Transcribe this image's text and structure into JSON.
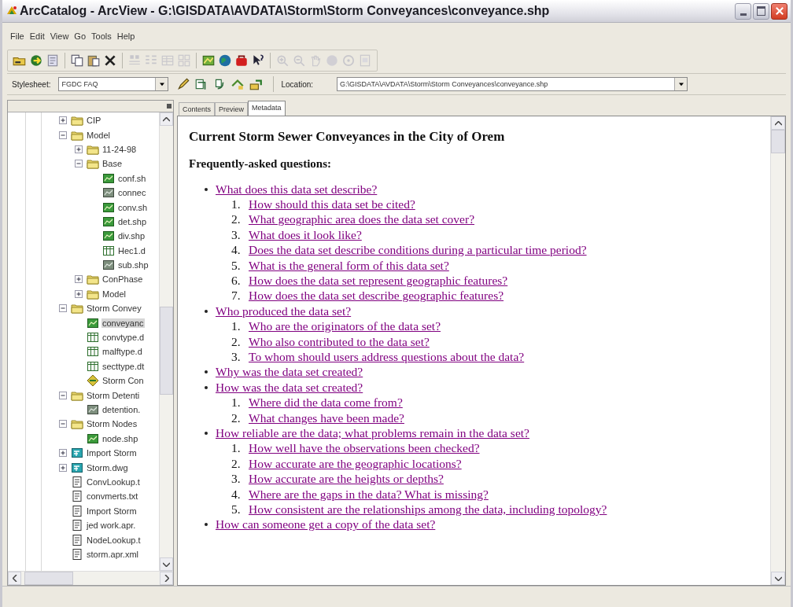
{
  "window": {
    "title": "ArcCatalog - ArcView - G:\\GISDATA\\AVDATA\\Storm\\Storm Conveyances\\conveyance.shp"
  },
  "menu": [
    "File",
    "Edit",
    "View",
    "Go",
    "Tools",
    "Help"
  ],
  "toolbar": [
    {
      "kind": "connect",
      "disabled": false
    },
    {
      "kind": "disconnect",
      "disabled": false
    },
    {
      "kind": "properties",
      "disabled": false
    },
    {
      "kind": "sep"
    },
    {
      "kind": "copy",
      "disabled": false
    },
    {
      "kind": "paste",
      "disabled": false
    },
    {
      "kind": "delete",
      "disabled": false
    },
    {
      "kind": "sep"
    },
    {
      "kind": "large-icons",
      "disabled": true
    },
    {
      "kind": "list",
      "disabled": true
    },
    {
      "kind": "details",
      "disabled": true
    },
    {
      "kind": "thumbnails",
      "disabled": true
    },
    {
      "kind": "sep"
    },
    {
      "kind": "arcmap",
      "disabled": false
    },
    {
      "kind": "globe",
      "disabled": false
    },
    {
      "kind": "toolbox",
      "disabled": false
    },
    {
      "kind": "help",
      "disabled": false
    },
    {
      "kind": "sep"
    },
    {
      "kind": "zoom-in",
      "disabled": true
    },
    {
      "kind": "zoom-out",
      "disabled": true
    },
    {
      "kind": "pan",
      "disabled": true
    },
    {
      "kind": "full-extent",
      "disabled": true
    },
    {
      "kind": "identify",
      "disabled": true
    },
    {
      "kind": "thumbnail",
      "disabled": true
    }
  ],
  "metadata_toolbar": {
    "stylesheet_label": "Stylesheet:",
    "stylesheet": "FGDC FAQ",
    "buttons": [
      {
        "kind": "edit",
        "disabled": false
      },
      {
        "kind": "properties-edit",
        "disabled": false
      },
      {
        "kind": "import",
        "disabled": false
      },
      {
        "kind": "export",
        "disabled": false
      },
      {
        "kind": "update",
        "disabled": false
      }
    ],
    "location_label": "Location:",
    "location": "G:\\GISDATA\\AVDATA\\Storm\\Storm Conveyances\\conveyance.shp"
  },
  "tree": [
    {
      "label": "CIP",
      "kind": "folder",
      "expanded": false
    },
    {
      "label": "Model",
      "kind": "folder",
      "expanded": true,
      "children": [
        {
          "label": "11-24-98",
          "kind": "folder",
          "expanded": false
        },
        {
          "label": "Base",
          "kind": "folder",
          "expanded": true,
          "children": [
            {
              "label": "conf.sh",
              "kind": "shapefile"
            },
            {
              "label": "connec",
              "kind": "dataset"
            },
            {
              "label": "conv.sh",
              "kind": "shapefile"
            },
            {
              "label": "det.shp",
              "kind": "shapefile"
            },
            {
              "label": "div.shp",
              "kind": "shapefile"
            },
            {
              "label": "Hec1.d",
              "kind": "table"
            },
            {
              "label": "sub.shp",
              "kind": "dataset"
            }
          ]
        },
        {
          "label": "ConPhase",
          "kind": "folder",
          "expanded": false
        },
        {
          "label": "Model",
          "kind": "folder",
          "expanded": false
        }
      ]
    },
    {
      "label": "Storm Convey",
      "kind": "folder",
      "expanded": true,
      "children": [
        {
          "label": "conveyanc",
          "kind": "shapefile",
          "selected": true
        },
        {
          "label": "convtype.d",
          "kind": "table",
          "selected": false
        },
        {
          "label": "malftype.d",
          "kind": "table",
          "selected": false
        },
        {
          "label": "secttype.dt",
          "kind": "table",
          "selected": false
        },
        {
          "label": "Storm Con",
          "kind": "layer",
          "selected": false
        }
      ]
    },
    {
      "label": "Storm Detenti",
      "kind": "folder",
      "expanded": true,
      "children": [
        {
          "label": "detention.",
          "kind": "dataset"
        }
      ]
    },
    {
      "label": "Storm Nodes",
      "kind": "folder",
      "expanded": true,
      "children": [
        {
          "label": "node.shp",
          "kind": "shapefile"
        }
      ]
    },
    {
      "label": "Import Storm",
      "kind": "cad",
      "expanded": false
    },
    {
      "label": "Storm.dwg",
      "kind": "cad",
      "expanded": false
    },
    {
      "label": "ConvLookup.t",
      "kind": "file"
    },
    {
      "label": "convmerts.txt",
      "kind": "file"
    },
    {
      "label": "Import Storm",
      "kind": "file"
    },
    {
      "label": "jed work.apr.",
      "kind": "file"
    },
    {
      "label": "NodeLookup.t",
      "kind": "file"
    },
    {
      "label": "storm.apr.xml",
      "kind": "file"
    }
  ],
  "tabs": [
    {
      "label": "Contents",
      "selected": false
    },
    {
      "label": "Preview",
      "selected": false
    },
    {
      "label": "Metadata",
      "selected": true
    }
  ],
  "document": {
    "title": "Current Storm Sewer Conveyances in the City of Orem",
    "subtitle": "Frequently-asked questions:",
    "sections": [
      {
        "text": "What does this data set describe?",
        "questions": [
          {
            "number": "1.",
            "text": "How should this data set be cited?"
          },
          {
            "number": "2.",
            "text": "What geographic area does the data set cover?"
          },
          {
            "number": "3.",
            "text": "What does it look like?"
          },
          {
            "number": "4.",
            "text": "Does the data set describe conditions during a particular time period?"
          },
          {
            "number": "5.",
            "text": "What is the general form of this data set?"
          },
          {
            "number": "6.",
            "text": "How does the data set represent geographic features?"
          },
          {
            "number": "7.",
            "text": "How does the data set describe geographic features?"
          }
        ]
      },
      {
        "text": "Who produced the data set?",
        "questions": [
          {
            "number": "1.",
            "text": "Who are the originators of the data set?"
          },
          {
            "number": "2.",
            "text": "Who also contributed to the data set?"
          },
          {
            "number": "3.",
            "text": "To whom should users address questions about the data?"
          }
        ]
      },
      {
        "text": "Why was the data set created?"
      },
      {
        "text": "How was the data set created?",
        "questions": [
          {
            "number": "1.",
            "text": "Where did the data come from?"
          },
          {
            "number": "2.",
            "text": "What changes have been made?"
          }
        ]
      },
      {
        "text": "How reliable are the data; what problems remain in the data set?",
        "questions": [
          {
            "number": "1.",
            "text": "How well have the observations been checked?"
          },
          {
            "number": "2.",
            "text": "How accurate are the geographic locations?"
          },
          {
            "number": "3.",
            "text": "How accurate are the heights or depths?"
          },
          {
            "number": "4.",
            "text": "Where are the gaps in the data? What is missing?"
          },
          {
            "number": "5.",
            "text": "How consistent are the relationships among the data, including topology?"
          }
        ]
      },
      {
        "text": "How can someone get a copy of the data set?"
      }
    ]
  }
}
